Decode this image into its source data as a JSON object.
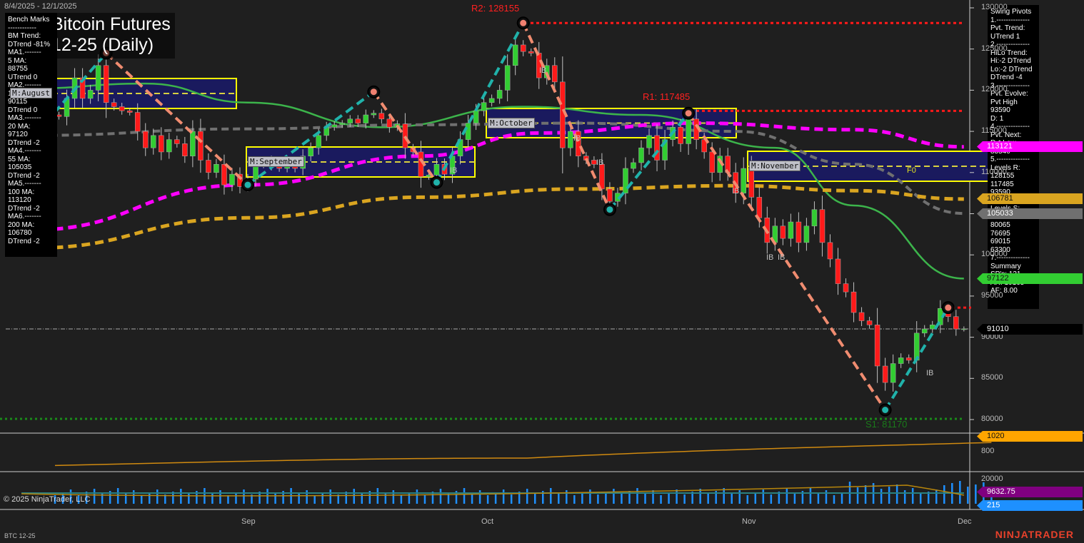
{
  "header": {
    "date_range": "8/4/2025 - 12/1/2025",
    "title_line1": "Bitcoin Futures",
    "title_line2": "12-25 (Daily)"
  },
  "bench_marks": {
    "lines": [
      "Bench Marks",
      "------------",
      "BM Trend:",
      "DTrend -81%",
      "MA1.-------",
      "5 MA:",
      "88755",
      "UTrend 0",
      "MA2.-------",
      "10 MA:",
      "90115",
      "DTrend 0",
      "MA3.-------",
      "20 MA:",
      "97120",
      "DTrend -2",
      "MA4.-------",
      "55 MA:",
      "105035",
      "DTrend -2",
      "MA5.-------",
      "100 MA:",
      "113120",
      "DTrend -2",
      "MA6.-------",
      "200 MA:",
      "106780",
      "DTrend -2"
    ]
  },
  "swing_pivots": {
    "lines": [
      "Swing Pivots",
      "1.--------------",
      "Pvt. Trend:",
      "UTrend 1",
      "2.--------------",
      "HiLo Trend:",
      "Hi:-2 DTrend",
      "Lo:-2 DTrend",
      "DTrend -4",
      "3.--------------",
      "Pvt. Evolve:",
      "Pvt High",
      "93590",
      "D: 1",
      "4.--------------",
      "Pvt. Next:",
      "Pvt Low",
      "83540",
      "5.--------------",
      "Levels R:",
      "128155",
      "117485",
      "93590",
      "6.--------------",
      "Levels S:",
      "81170",
      "80065",
      "76695",
      "69015",
      "63300",
      "7.--------------",
      "Summary",
      "SP's: 121",
      "AR: 10165",
      "AF: 8.00"
    ]
  },
  "levels": {
    "r2": "R2: 128155",
    "r1": "R1: 117485",
    "s1": "S1: 81170",
    "f0": "F0"
  },
  "month_boxes": [
    "M:August",
    "M:September",
    "M:October",
    "M:November"
  ],
  "ib_label": "IB",
  "price_tags": [
    {
      "label": "113121",
      "bg": "#ff00ff",
      "fg": "#ffffff"
    },
    {
      "label": "106781",
      "bg": "#daa520",
      "fg": "#111111"
    },
    {
      "label": "105033",
      "bg": "#707070",
      "fg": "#ffffff"
    },
    {
      "label": "97122",
      "bg": "#32cd32",
      "fg": "#111111"
    },
    {
      "label": "91010",
      "bg": "#000000",
      "fg": "#ffffff"
    },
    {
      "label": "1020",
      "bg": "#ffa500",
      "fg": "#111111"
    },
    {
      "label": "9632.75",
      "bg": "#800080",
      "fg": "#ffffff"
    },
    {
      "label": "215",
      "bg": "#1e90ff",
      "fg": "#ffffff"
    }
  ],
  "footer": {
    "copyright": "© 2025 NinjaTrader, LLC",
    "symbol": "BTC 12-25",
    "brand": "NINJATRADER"
  },
  "chart_data": {
    "type": "candlestick",
    "title": "Bitcoin Futures 12-25 (Daily)",
    "ylim": [
      78500,
      131000
    ],
    "y_ticks": [
      "130000",
      "125000",
      "120000",
      "115000",
      "110000",
      "105000",
      "100000",
      "95000",
      "90000",
      "85000",
      "80000"
    ],
    "x_ticks": [
      "Sep",
      "Oct",
      "Nov",
      "Dec"
    ],
    "indicator_ticks": [
      "800"
    ],
    "volume_ticks": [
      "20000"
    ],
    "closes": [
      114000,
      115000,
      114500,
      117000,
      116800,
      119000,
      121500,
      119000,
      120000,
      123000,
      118500,
      118000,
      117500,
      117300,
      115000,
      113000,
      114500,
      112500,
      114000,
      113500,
      112000,
      115000,
      111500,
      110000,
      111000,
      108500,
      109800,
      108300,
      109200,
      111000,
      111500,
      110800,
      110500,
      111000,
      110500,
      112000,
      113000,
      114500,
      115500,
      115800,
      116000,
      116500,
      116000,
      117000,
      117200,
      116500,
      115500,
      115900,
      113000,
      112500,
      109500,
      109700,
      111000,
      109800,
      112000,
      114000,
      116000,
      117500,
      118500,
      119000,
      120000,
      123000,
      125500,
      124700,
      124500,
      121500,
      123000,
      121000,
      113000,
      115000,
      112000,
      111500,
      111000,
      108000,
      106500,
      107500,
      110500,
      111200,
      113000,
      114500,
      111500,
      114000,
      115500,
      113500,
      116500,
      114000,
      112500,
      110000,
      112000,
      110000,
      107500,
      110500,
      107000,
      104500,
      101500,
      103500,
      102000,
      104000,
      101500,
      103500,
      105500,
      101500,
      99500,
      96500,
      95500,
      93000,
      92000,
      91500,
      86500,
      84500,
      86800,
      87500,
      87200,
      90500,
      91000,
      91500,
      93500,
      92500,
      91000,
      91010
    ],
    "pivots": [
      [
        0,
        113500
      ],
      [
        10,
        124500
      ],
      [
        28,
        108500
      ],
      [
        44,
        119800
      ],
      [
        52,
        108800
      ],
      [
        63,
        128155
      ],
      [
        74,
        105500
      ],
      [
        84,
        117200
      ],
      [
        109,
        81170
      ],
      [
        117,
        93590
      ]
    ],
    "moving_averages": [
      {
        "name": "20 MA",
        "value": 97122,
        "color": "#3cb44b",
        "points": [
          [
            0,
            120200
          ],
          [
            15,
            120800
          ],
          [
            28,
            118500
          ],
          [
            45,
            115500
          ],
          [
            63,
            118000
          ],
          [
            78,
            117000
          ],
          [
            95,
            113000
          ],
          [
            105,
            106000
          ],
          [
            119,
            97122
          ]
        ]
      },
      {
        "name": "55 MA",
        "value": 105033,
        "color": "#707070",
        "points": [
          [
            0,
            114500
          ],
          [
            28,
            115300
          ],
          [
            50,
            115800
          ],
          [
            70,
            116000
          ],
          [
            90,
            115000
          ],
          [
            105,
            111000
          ],
          [
            119,
            105033
          ]
        ]
      },
      {
        "name": "100 MA",
        "value": 113121,
        "color": "#ff00ff",
        "points": [
          [
            0,
            103000
          ],
          [
            28,
            108500
          ],
          [
            50,
            112000
          ],
          [
            65,
            114800
          ],
          [
            85,
            116000
          ],
          [
            105,
            115200
          ],
          [
            119,
            113121
          ]
        ]
      },
      {
        "name": "200 MA",
        "value": 106781,
        "color": "#daa520",
        "points": [
          [
            0,
            100800
          ],
          [
            28,
            104500
          ],
          [
            50,
            107000
          ],
          [
            70,
            108000
          ],
          [
            90,
            108400
          ],
          [
            105,
            107800
          ],
          [
            119,
            106781
          ]
        ]
      }
    ],
    "levels": {
      "R2": 128155,
      "R1": 117485,
      "S1": 81170,
      "last": 91010
    }
  }
}
